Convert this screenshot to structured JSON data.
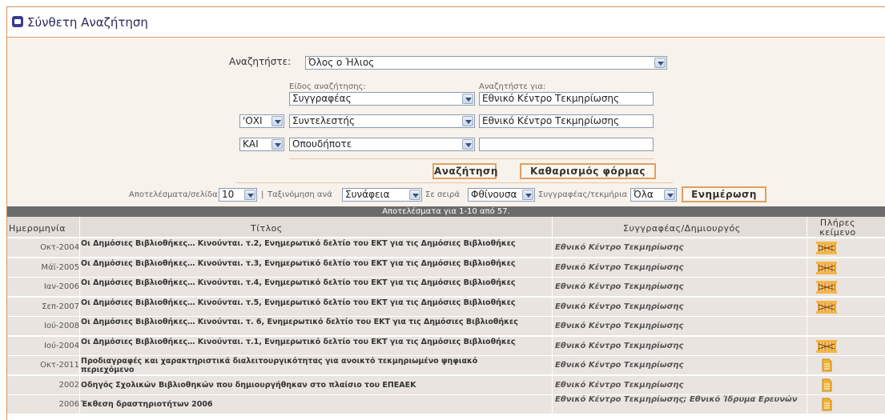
{
  "header": {
    "title": "Σύνθετη Αναζήτηση"
  },
  "form": {
    "search_in_label": "Αναζητήστε:",
    "search_in_value": "Όλος ο Ήλιος",
    "search_type_label": "Είδος αναζήτησης:",
    "search_for_label": "Αναζητήστε για:",
    "rows": [
      {
        "operator": "",
        "field": "Συγγραφέας",
        "term": "Εθνικό Κέντρο Τεκμηρίωσης"
      },
      {
        "operator": "'ΟΧΙ",
        "field": "Συντελεστής",
        "term": "Εθνικό Κέντρο Τεκμηρίωσης"
      },
      {
        "operator": "ΚΑΙ",
        "field": "Οπουδήποτε",
        "term": ""
      }
    ],
    "search_button": "Αναζήτηση",
    "clear_button": "Καθαρισμός φόρμας",
    "per_page_label": "Αποτελέσματα/σελίδα",
    "per_page_value": "10",
    "pipe": "|",
    "sort_label": "Ταξινόμηση ανά",
    "sort_value": "Συνάφεια",
    "order_label": "Σε σειρά",
    "order_value": "Φθίνουσα",
    "author_label": "Συγγραφέας/τεκμήρια",
    "author_value": "Όλα",
    "update_button": "Ενημέρωση"
  },
  "results": {
    "summary": "Αποτελέσματα για 1-10 από 57.",
    "columns": {
      "date": "Ημερομηνία",
      "title": "Τίτλος",
      "author": "Συγγραφέας/Δημιουργός",
      "fulltext_1": "Πλήρες",
      "fulltext_2": "κείμενο"
    },
    "rows": [
      {
        "date": "Οκτ-2004",
        "title": "Οι Δημόσιες Βιβλιοθήκες… Κινούνται. τ.2, Ενημερωτικό δελτίο του ΕΚΤ για τις Δημόσιες Βιβλιοθήκες",
        "author": "Εθνικό Κέντρο Τεκμηρίωσης",
        "icon": "books-icon"
      },
      {
        "date": "Μάϊ-2005",
        "title": "Οι Δημόσιες Βιβλιοθήκες… Κινούνται. τ.3, Ενημερωτικό δελτίο του ΕΚΤ για τις Δημόσιες Βιβλιοθήκες",
        "author": "Εθνικό Κέντρο Τεκμηρίωσης",
        "icon": "books-icon"
      },
      {
        "date": "Ιαν-2006",
        "title": "Οι Δημόσιες Βιβλιοθήκες… Κινούνται. τ.4, Ενημερωτικό δελτίο του ΕΚΤ για τις Δημόσιες Βιβλιοθήκες",
        "author": "Εθνικό Κέντρο Τεκμηρίωσης",
        "icon": "books-icon"
      },
      {
        "date": "Σεπ-2007",
        "title": "Οι Δημόσιες Βιβλιοθήκες… Κινούνται. τ.5, Ενημερωτικό δελτίο του ΕΚΤ για τις Δημόσιες Βιβλιοθήκες",
        "author": "Εθνικό Κέντρο Τεκμηρίωσης",
        "icon": "books-icon"
      },
      {
        "date": "Ιού-2008",
        "title": "Οι Δημόσιες Βιβλιοθήκες… Κινούνται. τ. 6, Ενημερωτικό δελτίο του ΕΚΤ για τις Δημόσιες Βιβλιοθήκες",
        "author": "Εθνικό Κέντρο Τεκμηρίωσης",
        "icon": ""
      },
      {
        "date": "Ιού-2004",
        "title": "Οι Δημόσιες Βιβλιοθήκες… Κινούνται. τ.1, Ενημερωτικό δελτίο του ΕΚΤ για τις Δημόσιες Βιβλιοθήκες",
        "author": "Εθνικό Κέντρο Τεκμηρίωσης",
        "icon": "books-icon"
      },
      {
        "date": "Οκτ-2011",
        "title": "Προδιαγραφές και χαρακτηριστικά διαλειτουργικότητας για ανοικτό τεκμηριωμένο ψηφιακό περιεχόμενο",
        "author": "Εθνικό Κέντρο Τεκμηρίωσης",
        "icon": "document-icon"
      },
      {
        "date": "2002",
        "title": "Οδηγός Σχολικών Βιβλιοθηκών που δημιουργήθηκαν στο πλαίσιο του ΕΠΕΑΕΚ",
        "author": "Εθνικό Κέντρο Τεκμηρίωσης",
        "icon": "document-icon"
      },
      {
        "date": "2006",
        "title": "Έκθεση δραστηριοτήτων 2006",
        "author": "Εθνικό Κέντρο Τεκμηρίωσης; Εθνικό Ίδρυμα Ερευνών",
        "icon": "document-icon"
      }
    ]
  },
  "colors": {
    "accent": "#e09050",
    "result_bar": "#6b6b6b",
    "row_bg": "#e9e4df",
    "icon_orange": "#f0a830"
  }
}
